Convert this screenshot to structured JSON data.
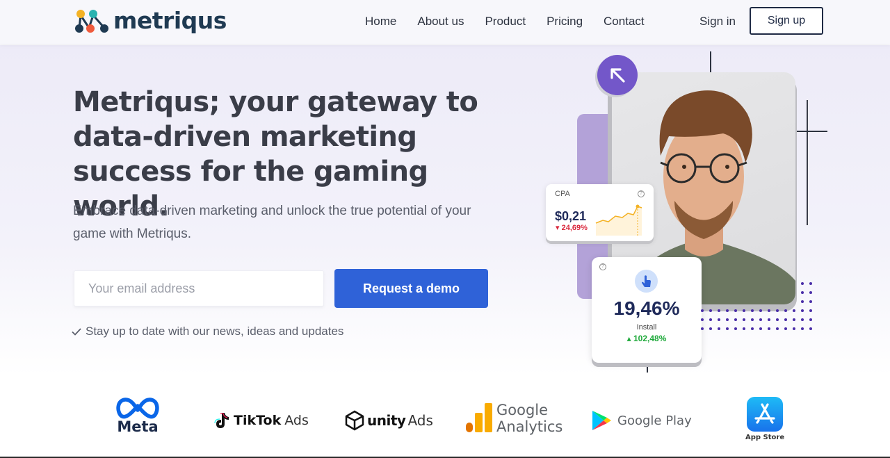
{
  "brand": {
    "name": "metriqus"
  },
  "nav": {
    "items": [
      "Home",
      "About us",
      "Product",
      "Pricing",
      "Contact"
    ],
    "sign_in": "Sign in",
    "sign_up": "Sign up"
  },
  "hero": {
    "title": "Metriqus; your gateway to data-driven marketing success for the gaming world.",
    "subtitle": "Embrace data-driven marketing and unlock the true potential of your game with Metriqus.",
    "email_placeholder": "Your email address",
    "cta_label": "Request a demo",
    "check_text": "Stay up to date with our news, ideas and updates"
  },
  "stats": {
    "cpa": {
      "label": "CPA",
      "value": "$0,21",
      "change": "24,69%",
      "direction": "down"
    },
    "install": {
      "label": "Install",
      "value": "19,46%",
      "change": "102,48%",
      "direction": "up"
    }
  },
  "partners": {
    "meta": "Meta",
    "tiktok": {
      "brand": "TikTok",
      "suffix": "Ads"
    },
    "unity": {
      "brand": "unity",
      "suffix": "Ads"
    },
    "google_analytics": {
      "line1": "Google",
      "line2": "Analytics"
    },
    "google_play": "Google Play",
    "app_store": "App Store"
  },
  "colors": {
    "accent_blue": "#2f62d8",
    "accent_purple": "#7357c9",
    "heading": "#3a3d48",
    "logo_navy": "#1f3a52",
    "positive": "#1ea93a",
    "negative": "#d9253a"
  },
  "icons": [
    "arrow-up-left-icon",
    "check-icon",
    "tap-icon",
    "question-icon"
  ]
}
